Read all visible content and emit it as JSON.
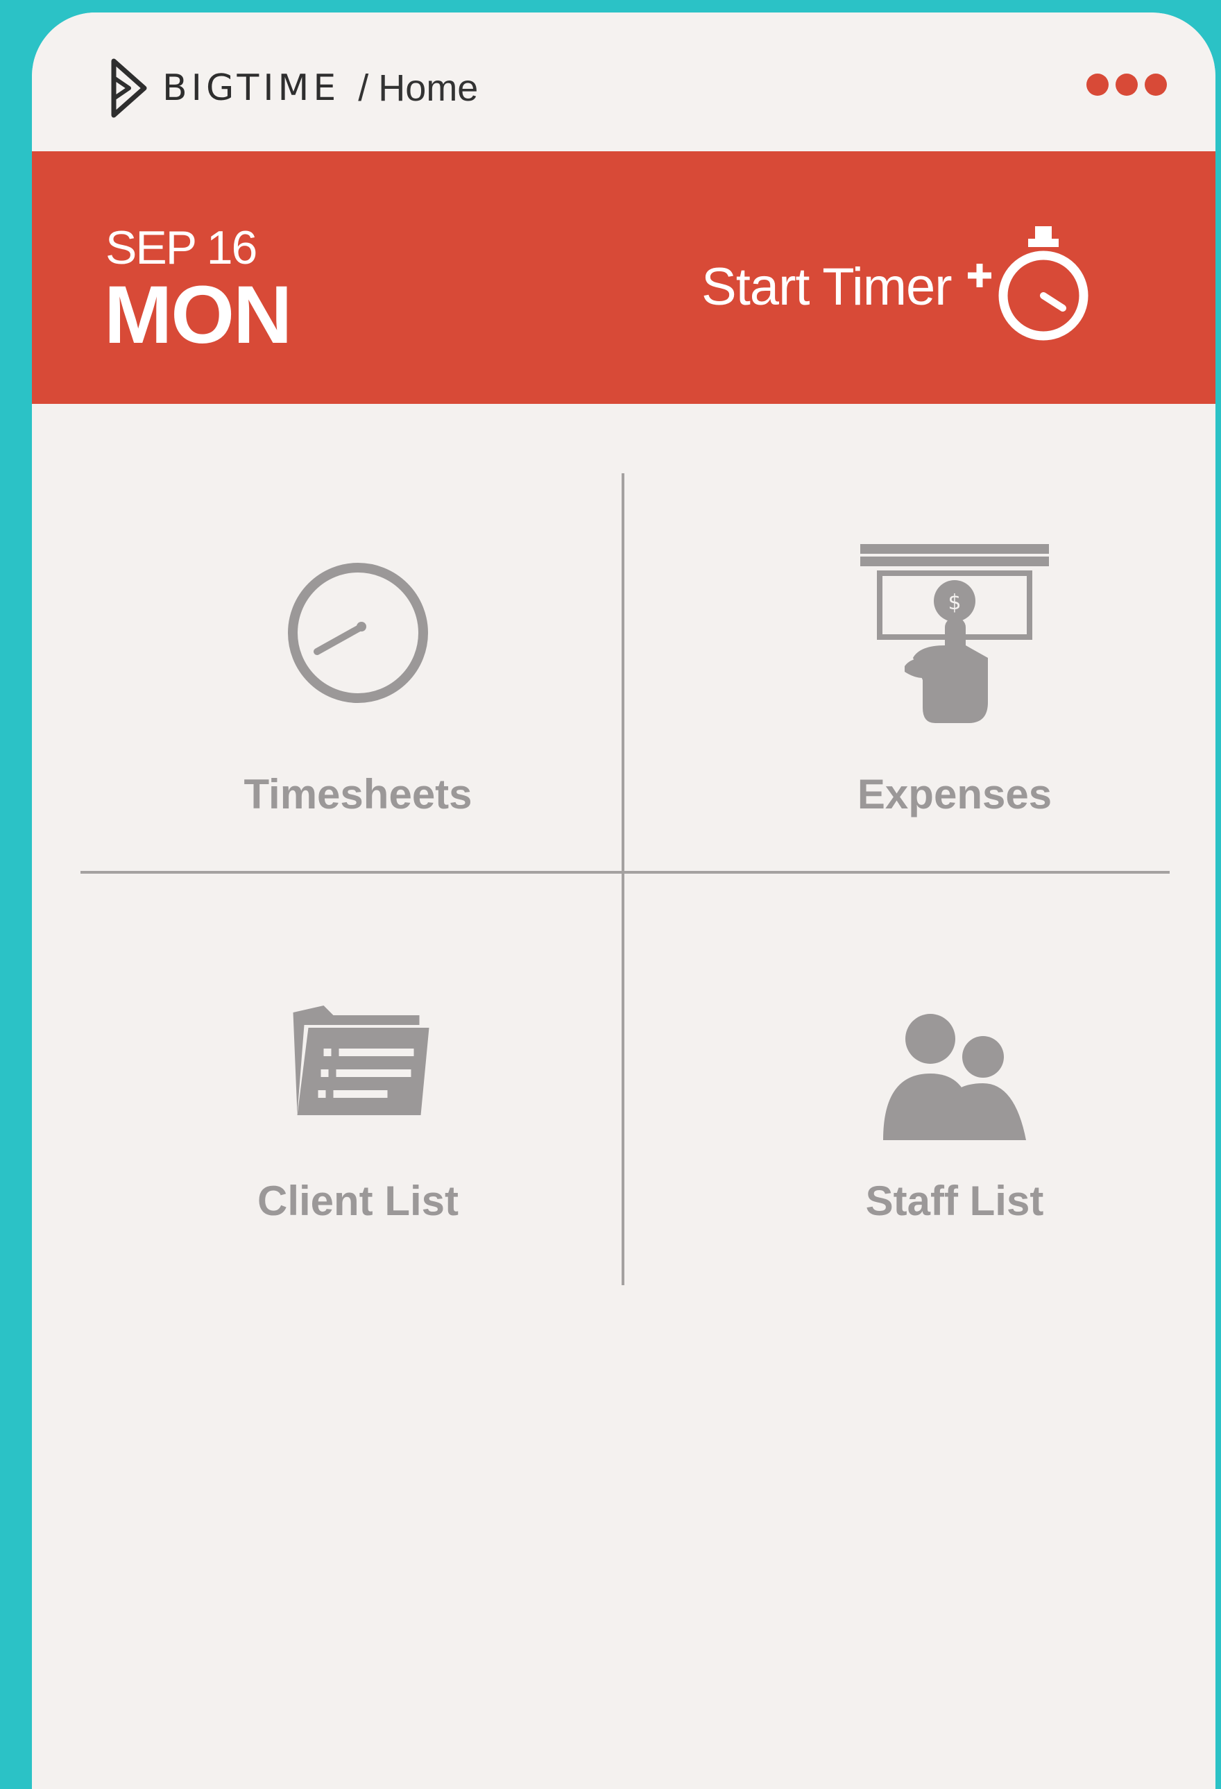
{
  "app": {
    "brand": "BIGTIME",
    "breadcrumb_separator": "/",
    "page_title": "Home",
    "menu_icon": "more-dots-icon",
    "accent_color": "#d84a37",
    "background_color": "#2bc2c6"
  },
  "header": {
    "date": "SEP 16",
    "weekday": "MON",
    "start_timer_label": "Start Timer",
    "timer_icon": "stopwatch-plus-icon"
  },
  "tiles": [
    {
      "label": "Timesheets",
      "icon": "speedometer-icon"
    },
    {
      "label": "Expenses",
      "icon": "atm-cash-icon"
    },
    {
      "label": "Client List",
      "icon": "folder-list-icon"
    },
    {
      "label": "Staff List",
      "icon": "people-icon"
    }
  ]
}
